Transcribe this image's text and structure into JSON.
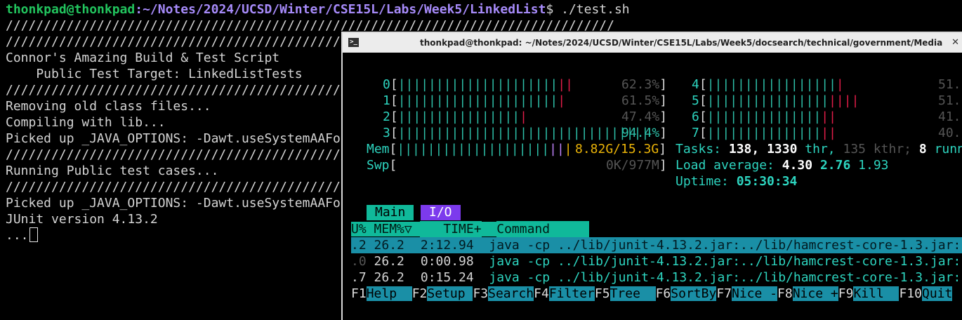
{
  "terminal": {
    "prompt_user": "thonkpad@thonkpad",
    "prompt_path": ":~/Notes/2024/UCSD/Winter/CSE15L/Labs/Week5/LinkedList",
    "prompt_cmd": "$ ./test.sh",
    "lines": [
      "////////////////////////////////////////////////////////////////////////////////",
      "////////////////////////////////////////////////////////////////////////////////",
      "Connor's Amazing Build & Test Script",
      "    Public Test Target: LinkedListTests",
      "////////////////////////////////////////////////////////////////////////////////",
      "Removing old class files...",
      "Compiling with lib...",
      "Picked up _JAVA_OPTIONS: -Dawt.useSystemAAFontSettings=on",
      "////////////////////////////////////////////////////////////////////////////////",
      "Running Public test cases...",
      "////////////////////////////////////////////////////////////////////////////////",
      "Picked up _JAVA_OPTIONS: -Dawt.useSystemAAFontSettings=on",
      "JUnit version 4.13.2",
      "..."
    ]
  },
  "htop_window": {
    "title": "thonkpad@thonkpad: ~/Notes/2024/UCSD/Winter/CSE15L/Labs/Week5/docsearch/technical/government/Media",
    "icon_glyph": ">_",
    "close_glyph": "✕",
    "cpus": [
      {
        "id": "0",
        "green": "|||||||||||||||||||||",
        "red": "||",
        "pct": "62.3%"
      },
      {
        "id": "1",
        "green": "|||||||||||||||||||||",
        "red": "|",
        "pct": "61.5%"
      },
      {
        "id": "2",
        "green": "||||||||||||||||",
        "red": "|",
        "pct": "47.4%"
      },
      {
        "id": "3",
        "green": "|||||||||||||||||||||||||||||||||",
        "red": "",
        "pct": "94.4%"
      },
      {
        "id": "4",
        "green": "|||||||||||||||||",
        "red": "|",
        "pct": "51."
      },
      {
        "id": "5",
        "green": "||||||||||||||||",
        "red": "||||",
        "pct": "51."
      },
      {
        "id": "6",
        "green": "|||||||||||||||",
        "red": "||",
        "pct": "41."
      },
      {
        "id": "7",
        "green": "|||||||||||||||",
        "red": "||",
        "pct": "40."
      }
    ],
    "mem": {
      "label": "Mem",
      "bar": "||||||||||||||||||||",
      "value": "8.82G/15.3G"
    },
    "swp": {
      "label": "Swp",
      "value": "0K/977M"
    },
    "tasks": {
      "label": "Tasks:",
      "count": "138,",
      "thr": "1330",
      "thr_label": "thr,",
      "kthr": "135 kthr;",
      "running": "8",
      "running_label": "runn"
    },
    "load": {
      "label": "Load average:",
      "l1": "4.30",
      "l5": "2.76",
      "l15": "1.93"
    },
    "uptime": {
      "label": "Uptime:",
      "value": "05:30:34"
    },
    "tabs": [
      "Main",
      "I/O"
    ],
    "columns": {
      "cpu": "U%",
      "mem": "MEM%▽",
      "time": "TIME+",
      "command": "Command"
    },
    "processes": [
      {
        "cpu": ".2",
        "mem": "26.2",
        "time": "2:12.94",
        "command": "java -cp ../lib/junit-4.13.2.jar:../lib/hamcrest-core-1.3.jar:"
      },
      {
        "cpu": ".0",
        "mem": "26.2",
        "time": "0:00.98",
        "command": "java -cp ../lib/junit-4.13.2.jar:../lib/hamcrest-core-1.3.jar:"
      },
      {
        "cpu": ".7",
        "mem": "26.2",
        "time": "0:15.24",
        "command": "java -cp ../lib/junit-4.13.2.jar:../lib/hamcrest-core-1.3.jar:"
      }
    ],
    "fkeys": [
      {
        "key": "F1",
        "label": "Help  "
      },
      {
        "key": "F2",
        "label": "Setup "
      },
      {
        "key": "F3",
        "label": "Search"
      },
      {
        "key": "F4",
        "label": "Filter"
      },
      {
        "key": "F5",
        "label": "Tree  "
      },
      {
        "key": "F6",
        "label": "SortBy"
      },
      {
        "key": "F7",
        "label": "Nice -"
      },
      {
        "key": "F8",
        "label": "Nice +"
      },
      {
        "key": "F9",
        "label": "Kill  "
      },
      {
        "key": "F10",
        "label": "Quit"
      }
    ]
  }
}
